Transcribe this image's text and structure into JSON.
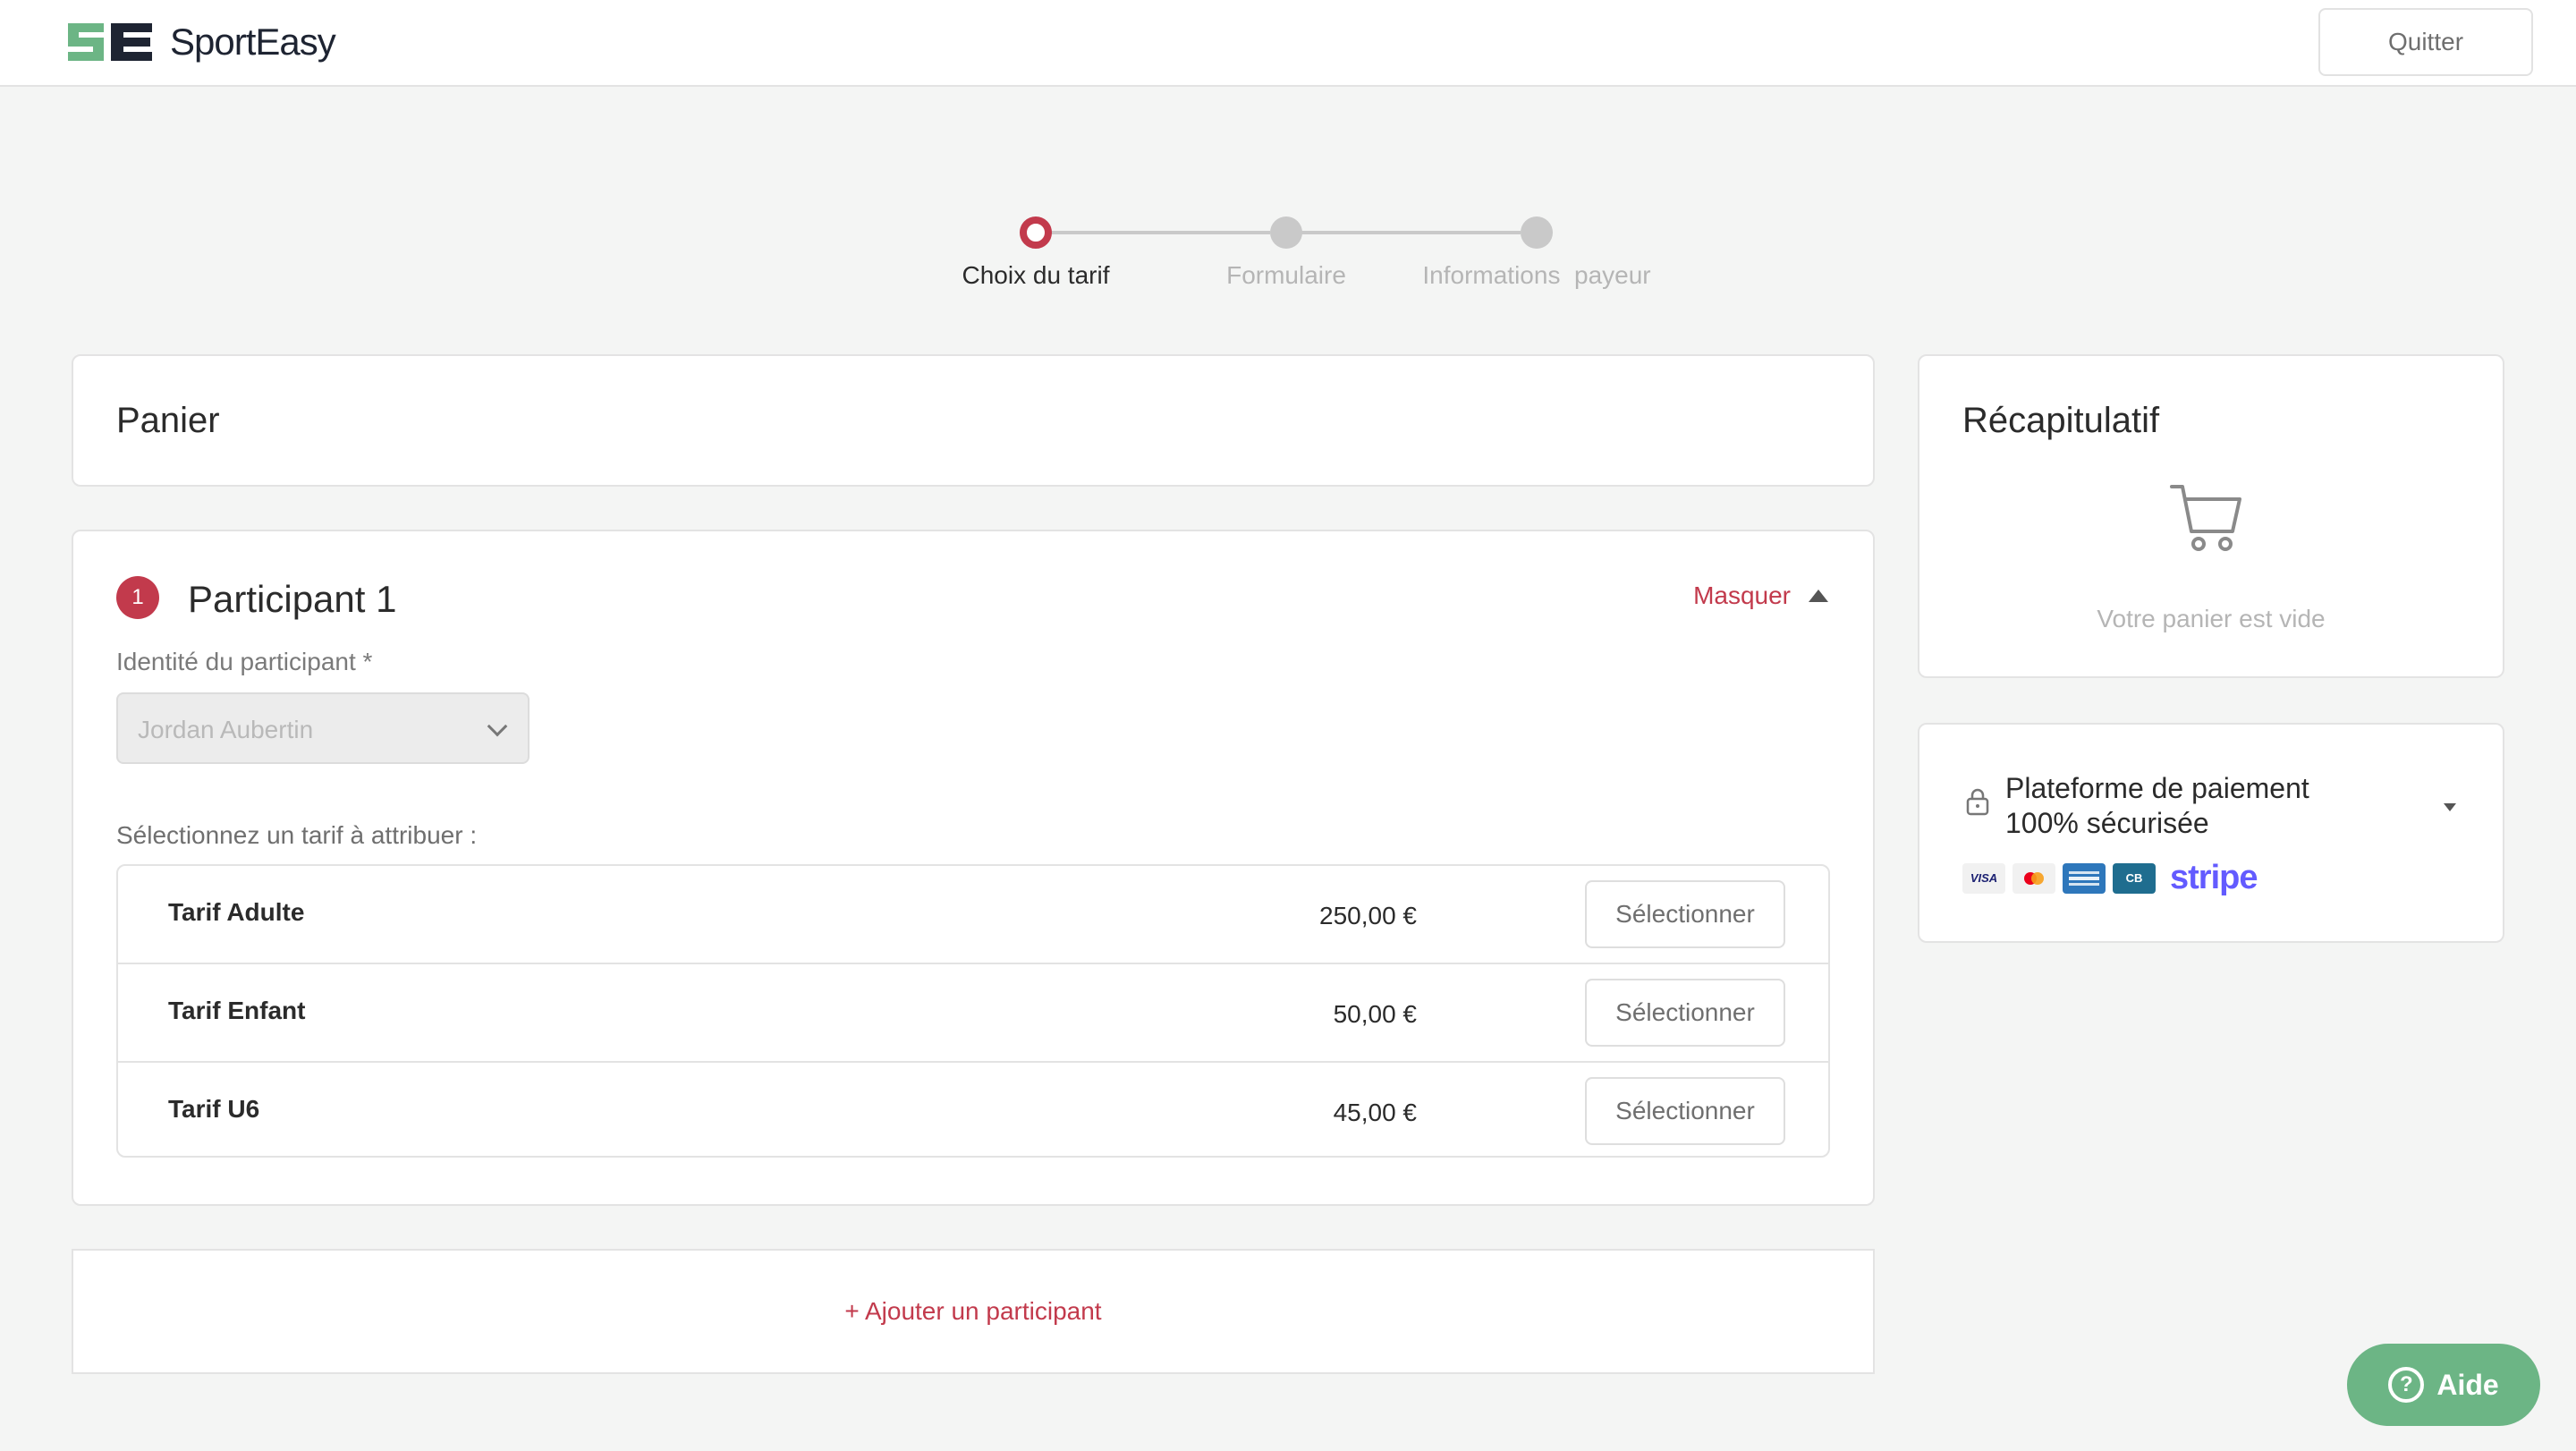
{
  "header": {
    "brand": "SportEasy",
    "quit_label": "Quitter"
  },
  "stepper": {
    "steps": [
      "Choix du tarif",
      "Formulaire",
      "Informations  payeur"
    ],
    "active_index": 0
  },
  "panier": {
    "title": "Panier"
  },
  "participant": {
    "number": "1",
    "title": "Participant 1",
    "toggle_label": "Masquer",
    "identity_label": "Identité du participant *",
    "identity_value": "Jordan Aubertin",
    "tarif_prompt": "Sélectionnez un tarif à attribuer :",
    "tarifs": [
      {
        "name": "Tarif Adulte",
        "price": "250,00 €",
        "button": "Sélectionner"
      },
      {
        "name": "Tarif Enfant",
        "price": "50,00 €",
        "button": "Sélectionner"
      },
      {
        "name": "Tarif U6",
        "price": "45,00 €",
        "button": "Sélectionner"
      }
    ]
  },
  "add_participant": {
    "label": "+ Ajouter un participant"
  },
  "recap": {
    "title": "Récapitulatif",
    "empty_text": "Votre panier est vide",
    "icon": "cart-icon"
  },
  "secure_payment": {
    "line1": "Plateforme de paiement",
    "line2": "100% sécurisée",
    "icon": "lock-icon",
    "methods": [
      "VISA",
      "Mastercard",
      "American Express",
      "CB"
    ],
    "provider": "stripe"
  },
  "help": {
    "label": "Aide"
  },
  "colors": {
    "accent": "#c23a4c",
    "brand_green": "#6cb585",
    "stripe": "#635bff",
    "background": "#f4f5f4"
  }
}
